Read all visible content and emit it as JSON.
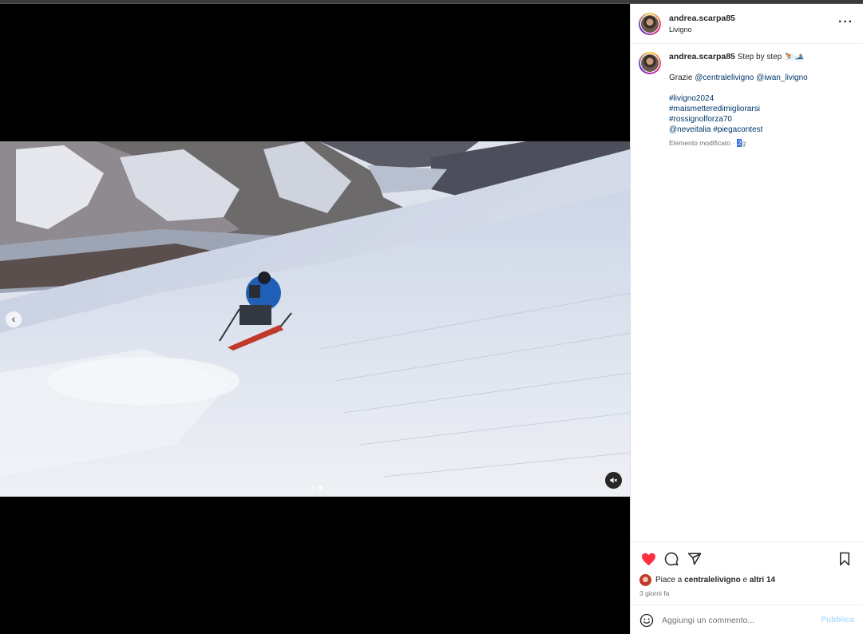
{
  "post": {
    "username": "andrea.scarpa85",
    "location": "Livigno",
    "more_icon": "more-horizontal-icon"
  },
  "caption": {
    "username": "andrea.scarpa85",
    "text": "Step by step",
    "emojis": "⛷️🎿",
    "thanks_prefix": "Grazie",
    "mention_1": "@centralelivigno",
    "mention_2": "@iwan_livigno",
    "hashtag_1": "#livigno2024",
    "hashtag_2": "#maismetteredimigliorarsi",
    "hashtag_3": "#rossignolforza70",
    "mention_3": "@neveitalia",
    "hashtag_4": "#piegacontest",
    "edited_label": "Elemento modificato · ",
    "edited_time_a": "2",
    "edited_time_b": "g"
  },
  "media": {
    "prev_icon": "chevron-left-icon",
    "prev_glyph": "‹",
    "mute_icon": "muted-speaker-icon",
    "slide_count": 2,
    "active_slide": 2
  },
  "actions": {
    "like_color": "#ff3040",
    "likes_prefix": "Piace a ",
    "likes_user": "centralelivigno",
    "likes_middle": " e ",
    "likes_others": "altri 14",
    "time_ago": "3 giorni fa"
  },
  "comment": {
    "placeholder": "Aggiungi un commento...",
    "publish_label": "Pubblica"
  }
}
